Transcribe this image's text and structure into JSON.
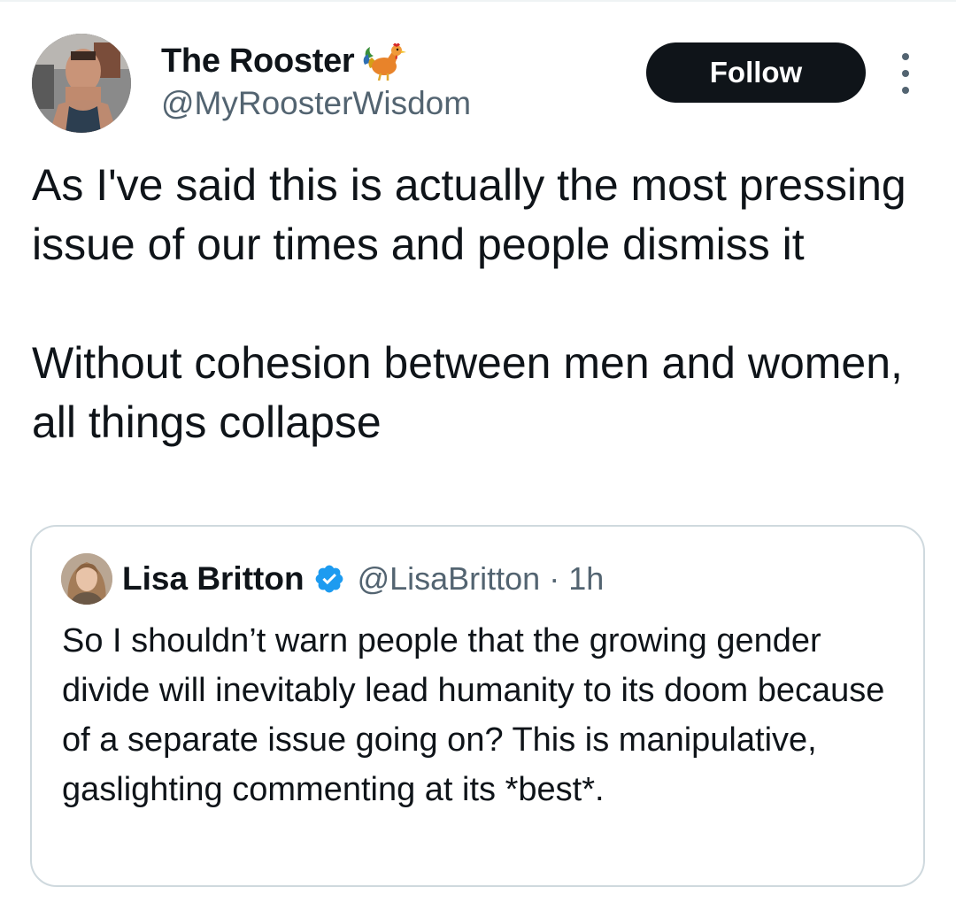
{
  "tweet": {
    "author": {
      "display_name": "The Rooster",
      "name_emoji": "rooster-emoji",
      "handle": "@MyRoosterWisdom",
      "avatar_icon": "user-avatar"
    },
    "follow_label": "Follow",
    "more_icon": "more-options-icon",
    "text_paragraphs": [
      "As I've said this is actually the most pressing issue of our times and people dismiss it",
      "Without cohesion between men and women, all things collapse"
    ]
  },
  "quoted_tweet": {
    "author": {
      "display_name": "Lisa Britton",
      "verified_icon": "verified-badge-icon",
      "handle": "@LisaBritton",
      "separator": "·",
      "time": "1h",
      "avatar_icon": "user-avatar"
    },
    "text": "So I shouldn’t warn people that the growing gender divide will inevitably lead humanity to its doom because of a separate issue going on? This is manipulative, gaslighting commenting at its *best*."
  },
  "colors": {
    "text_primary": "#0f1419",
    "text_secondary": "#536471",
    "follow_bg": "#0f1419",
    "follow_text": "#ffffff",
    "verified_blue": "#1d9bf0",
    "card_border": "#cfd9de"
  }
}
